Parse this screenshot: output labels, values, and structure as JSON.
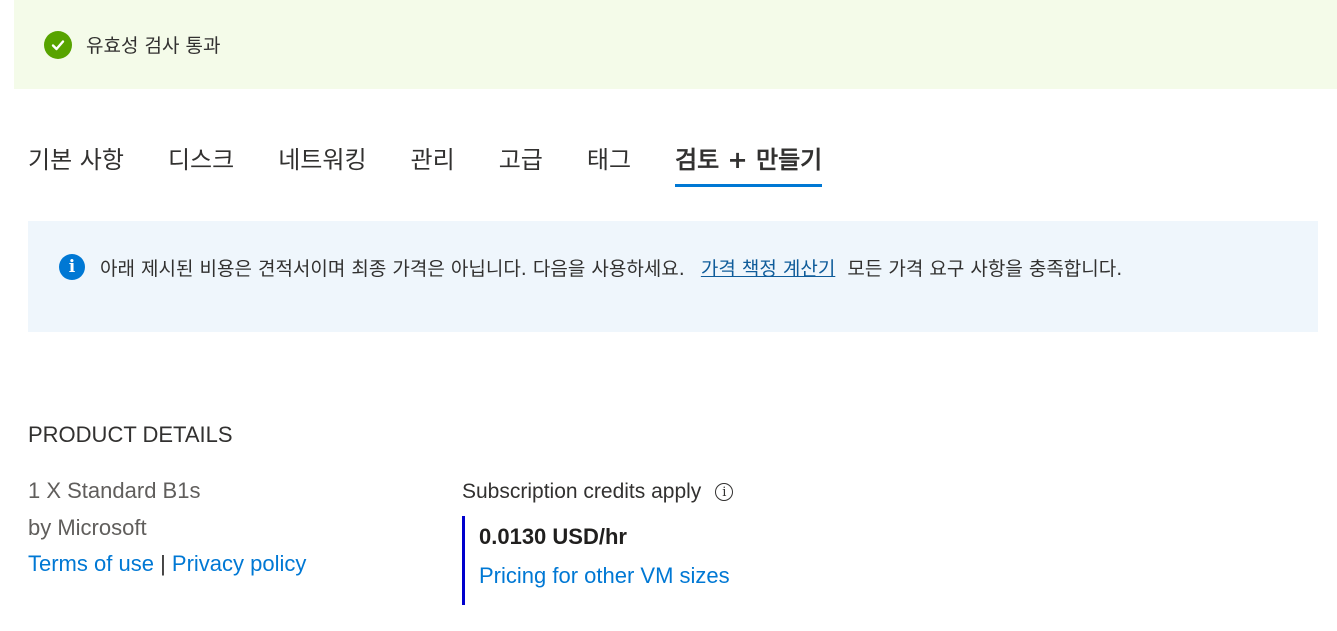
{
  "validation": {
    "status_text": "유효성 검사 통과",
    "icon": "check-circle-icon",
    "color": "#57a300"
  },
  "tabs": [
    {
      "label": "기본 사항",
      "active": false
    },
    {
      "label": "디스크",
      "active": false
    },
    {
      "label": "네트워킹",
      "active": false
    },
    {
      "label": "관리",
      "active": false
    },
    {
      "label": "고급",
      "active": false
    },
    {
      "label": "태그",
      "active": false
    },
    {
      "label": "검토 + 만들기",
      "active": true
    }
  ],
  "info_box": {
    "icon": "info-icon",
    "text_before": "아래 제시된 비용은 견적서이며 최종 가격은 아닙니다. 다음을 사용하세요.",
    "link_text": "가격 책정 계산기",
    "text_after": "모든 가격 요구 사항을 충족합니다."
  },
  "product_details": {
    "title": "PRODUCT DETAILS",
    "product_name": "1 X Standard B1s",
    "publisher": "by Microsoft",
    "terms_link": "Terms of use",
    "separator": "|",
    "privacy_link": "Privacy policy",
    "credits_label": "Subscription credits apply",
    "price": "0.0130 USD/hr",
    "pricing_link": "Pricing for other VM sizes"
  },
  "colors": {
    "accent": "#0078d4",
    "validation_bg": "#f4fbe9",
    "info_bg": "#eff6fc"
  }
}
